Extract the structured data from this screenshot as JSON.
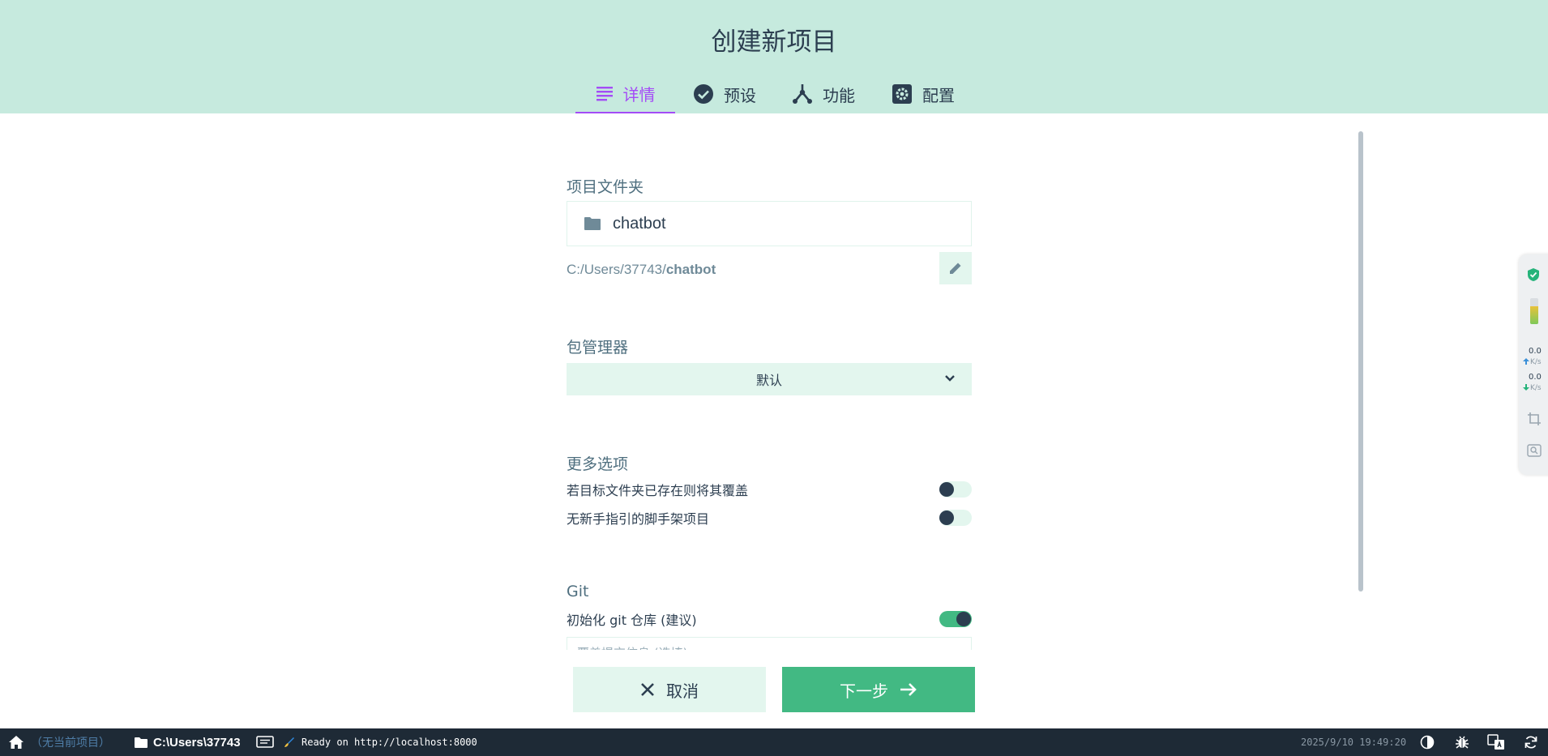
{
  "header": {
    "title": "创建新项目",
    "tabs": [
      {
        "label": "详情",
        "icon": "list-icon",
        "active": true
      },
      {
        "label": "预设",
        "icon": "check-circle-icon",
        "active": false
      },
      {
        "label": "功能",
        "icon": "fork-icon",
        "active": false
      },
      {
        "label": "配置",
        "icon": "settings-icon",
        "active": false
      }
    ]
  },
  "form": {
    "folder_section_label": "项目文件夹",
    "folder_name": "chatbot",
    "path_prefix": "C:/Users/37743/",
    "path_folder": "chatbot",
    "package_manager_label": "包管理器",
    "package_manager_value": "默认",
    "more_options_label": "更多选项",
    "options": [
      {
        "label": "若目标文件夹已存在则将其覆盖",
        "enabled": false
      },
      {
        "label": "无新手指引的脚手架项目",
        "enabled": false
      }
    ],
    "git_label": "Git",
    "git_init_label": "初始化 git 仓库 (建议)",
    "git_init_enabled": true,
    "commit_placeholder": "覆盖提交信息 (选填)"
  },
  "actions": {
    "cancel_label": "取消",
    "next_label": "下一步"
  },
  "side_widget": {
    "upload_speed": "0.0",
    "upload_unit": "K/s",
    "download_speed": "0.0",
    "download_unit": "K/s"
  },
  "statusbar": {
    "current_project": "（无当前项目）",
    "cwd": "C:\\Users\\37743",
    "log": "Ready on http://localhost:8000",
    "timestamp": "2025/9/10 19:49:20"
  },
  "colors": {
    "header_bg": "#c6eade",
    "accent_purple": "#a44cf6",
    "primary_green": "#42b983",
    "light_green": "#e3f6ee",
    "text_dark": "#2c3e50",
    "statusbar_bg": "#1e2a36"
  }
}
